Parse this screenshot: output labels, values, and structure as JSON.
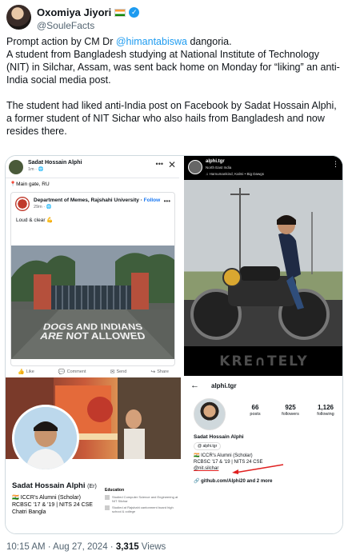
{
  "author": {
    "name": "Oxomiya Jiyori",
    "handle": "@SouleFacts"
  },
  "tweet": {
    "p1_before": "Prompt action by CM Dr ",
    "p1_mention": "@himantabiswa",
    "p1_after": " dangoria.\nA student from Bangladesh studying at National Institute of Technology (NIT) in Silchar, Assam, was sent back home on Monday for “liking” an anti-India social media post.",
    "p2": "The student had liked anti-India post on Facebook by Sadat Hossain Alphi, a former student of NIT Sichar who also hails from Bangladesh and now resides there."
  },
  "media": {
    "fb_post": {
      "poster": "Sadat Hossain Alphi",
      "time": "1m · ",
      "location": "Main gate, RU",
      "page_name": "Department of Memes, Rajshahi University · ",
      "follow": "Follow",
      "page_time": "29m · ",
      "caption": "Loud & clear",
      "photo_text_1": "DOGS AND INDIANS",
      "photo_text_2": "ARE NOT ALLOWED",
      "actions": [
        "Like",
        "Comment",
        "Send",
        "Share"
      ]
    },
    "bike_reel": {
      "user": "alphi.tgr",
      "sub": "North East India",
      "audio": "Hamumankind, Kalmi • Big Dawgs",
      "watermark": "KRE∩TELY"
    },
    "profile": {
      "name": "Sadat Hossain Alphi",
      "suffix": "(Er)",
      "lines": [
        "ICCR's Alumni (Scholar)",
        "RCBSC '17 & '19 | NITS 24 CSE",
        "Chatri Bangla"
      ],
      "education_title": "Education",
      "education": [
        "Studied Computer Science and Engineering at NIT Silchar",
        "Studied at Rajshahi cantonment board high school & college"
      ]
    },
    "instagram": {
      "username": "alphi.tgr",
      "stats": [
        {
          "n": "66",
          "l": "posts"
        },
        {
          "n": "925",
          "l": "followers"
        },
        {
          "n": "1,126",
          "l": "following"
        }
      ],
      "name": "Sadat Hossain Alphi",
      "thread": "alphi.tgr",
      "bio": [
        "ICCR's Alumni (Scholar)",
        "RCBSC '17 & '19 | NITS 24 CSE",
        "@nit.silchar"
      ],
      "link": "github.com/Alphi20 and 2 more"
    }
  },
  "meta": {
    "time": "10:15 AM · Aug 27, 2024 · ",
    "views_count": "3,315",
    "views_label": " Views"
  }
}
